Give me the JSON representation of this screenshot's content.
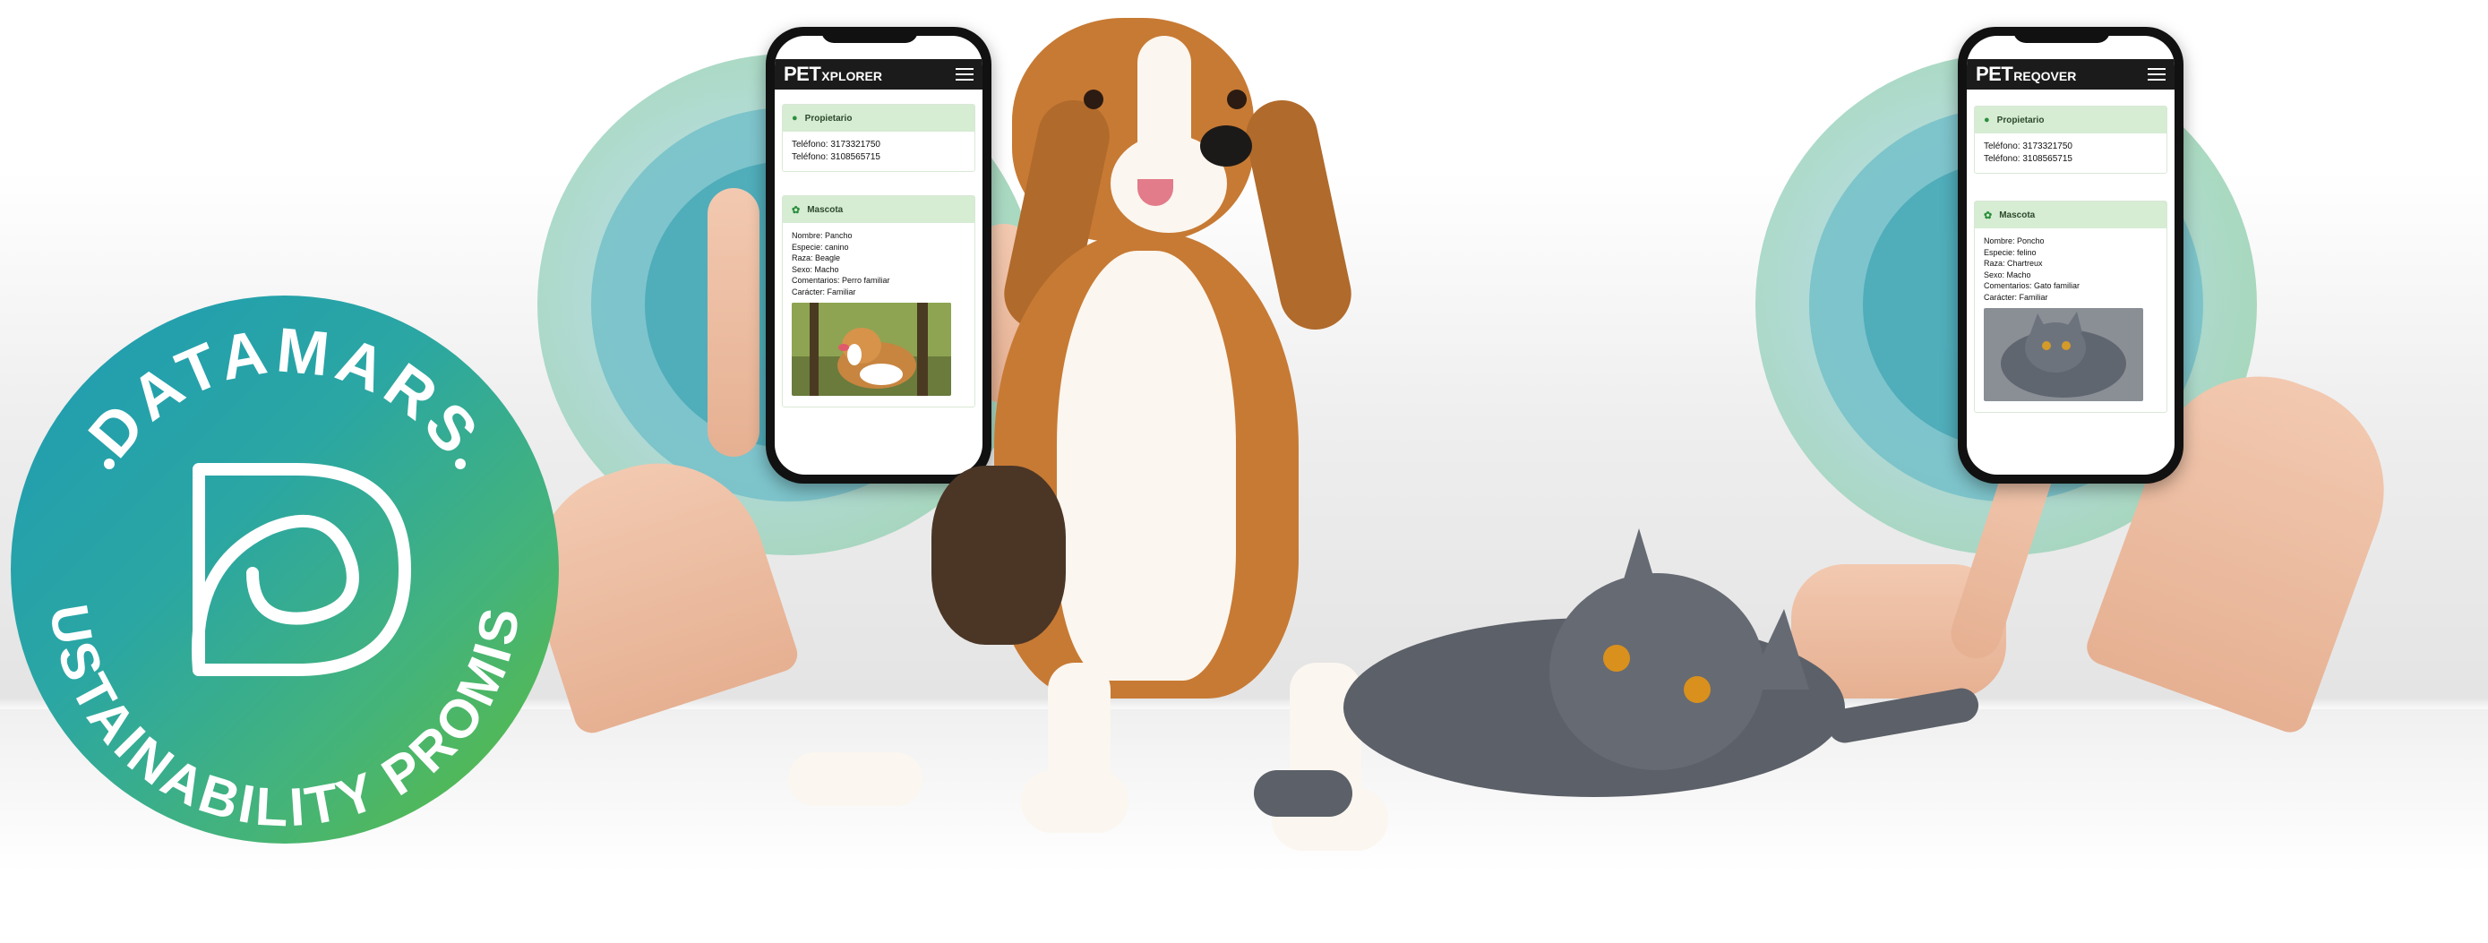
{
  "badge": {
    "top_text": "DATAMARS",
    "bottom_text": "SUSTAINABILITY PROMISE",
    "colors": {
      "start": "#1f9bb3",
      "end": "#5cbd3a"
    }
  },
  "phone_left": {
    "brand_main": "PET",
    "brand_sub": "XPLORER",
    "menu_icon": "hamburger-icon",
    "owner": {
      "title": "Propietario",
      "icon": "person-icon",
      "phone1": "Teléfono: 3173321750",
      "phone2": "Teléfono: 3108565715"
    },
    "pet": {
      "title": "Mascota",
      "icon": "paw-icon",
      "lines": [
        "Nombre: Pancho",
        "Especie: canino",
        "Raza: Beagle",
        "Sexo: Macho",
        "Comentarios: Perro familiar",
        "Carácter: Familiar"
      ],
      "photo": "beagle-photo"
    }
  },
  "phone_right": {
    "brand_main": "PET",
    "brand_sub": "REQOVER",
    "menu_icon": "hamburger-icon",
    "owner": {
      "title": "Propietario",
      "icon": "person-icon",
      "phone1": "Teléfono: 3173321750",
      "phone2": "Teléfono: 3108565715"
    },
    "pet": {
      "title": "Mascota",
      "icon": "paw-icon",
      "lines": [
        "Nombre: Poncho",
        "Especie: felino",
        "Raza: Chartreux",
        "Sexo: Macho",
        "Comentarios: Gato familiar",
        "Carácter: Familiar"
      ],
      "photo": "cat-photo"
    }
  },
  "colors": {
    "accent_teal": "#3aa7b5",
    "accent_green": "#8ed08a",
    "card_header": "#d6ecd3",
    "appbar": "#1b1b1b"
  }
}
